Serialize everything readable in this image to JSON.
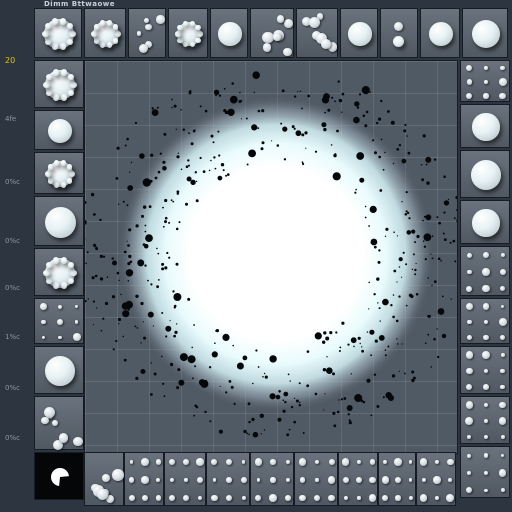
{
  "header": {
    "title": "Dimm  Bttwaowe"
  },
  "axis_labels": [
    "20",
    "4fe",
    "0%c",
    "0%c",
    "0%c",
    "1%c",
    "0%c",
    "0%c"
  ],
  "colors": {
    "background": "#2c3540",
    "canvas": "#505a65",
    "glow": "#ffffff",
    "halo": "#d9f2f5",
    "accent_label": "#e4c400"
  },
  "palette": {
    "top_row": [
      "bumpy-sphere",
      "spiky-blob",
      "dots-cluster",
      "star-blob",
      "sphere",
      "dots-cluster",
      "dots-cluster",
      "sphere",
      "dots-pair",
      "sphere",
      "sphere"
    ],
    "left_column": [
      "bumpy-sphere",
      "sphere",
      "blob",
      "sphere",
      "blob",
      "dots-grid",
      "sphere",
      "dots-cluster",
      "black-crescent"
    ],
    "right_column": [
      "dots-grid",
      "sphere",
      "sphere",
      "sphere",
      "dots-grid",
      "dots-grid",
      "dots-grid",
      "dots-grid",
      "dots-grid"
    ],
    "bottom_row": [
      "dots-cluster",
      "dots-grid",
      "dots-grid",
      "dots-grid",
      "dots-grid",
      "dots-grid",
      "dots-grid",
      "dots-grid",
      "dots-grid",
      "dots-grid"
    ]
  }
}
